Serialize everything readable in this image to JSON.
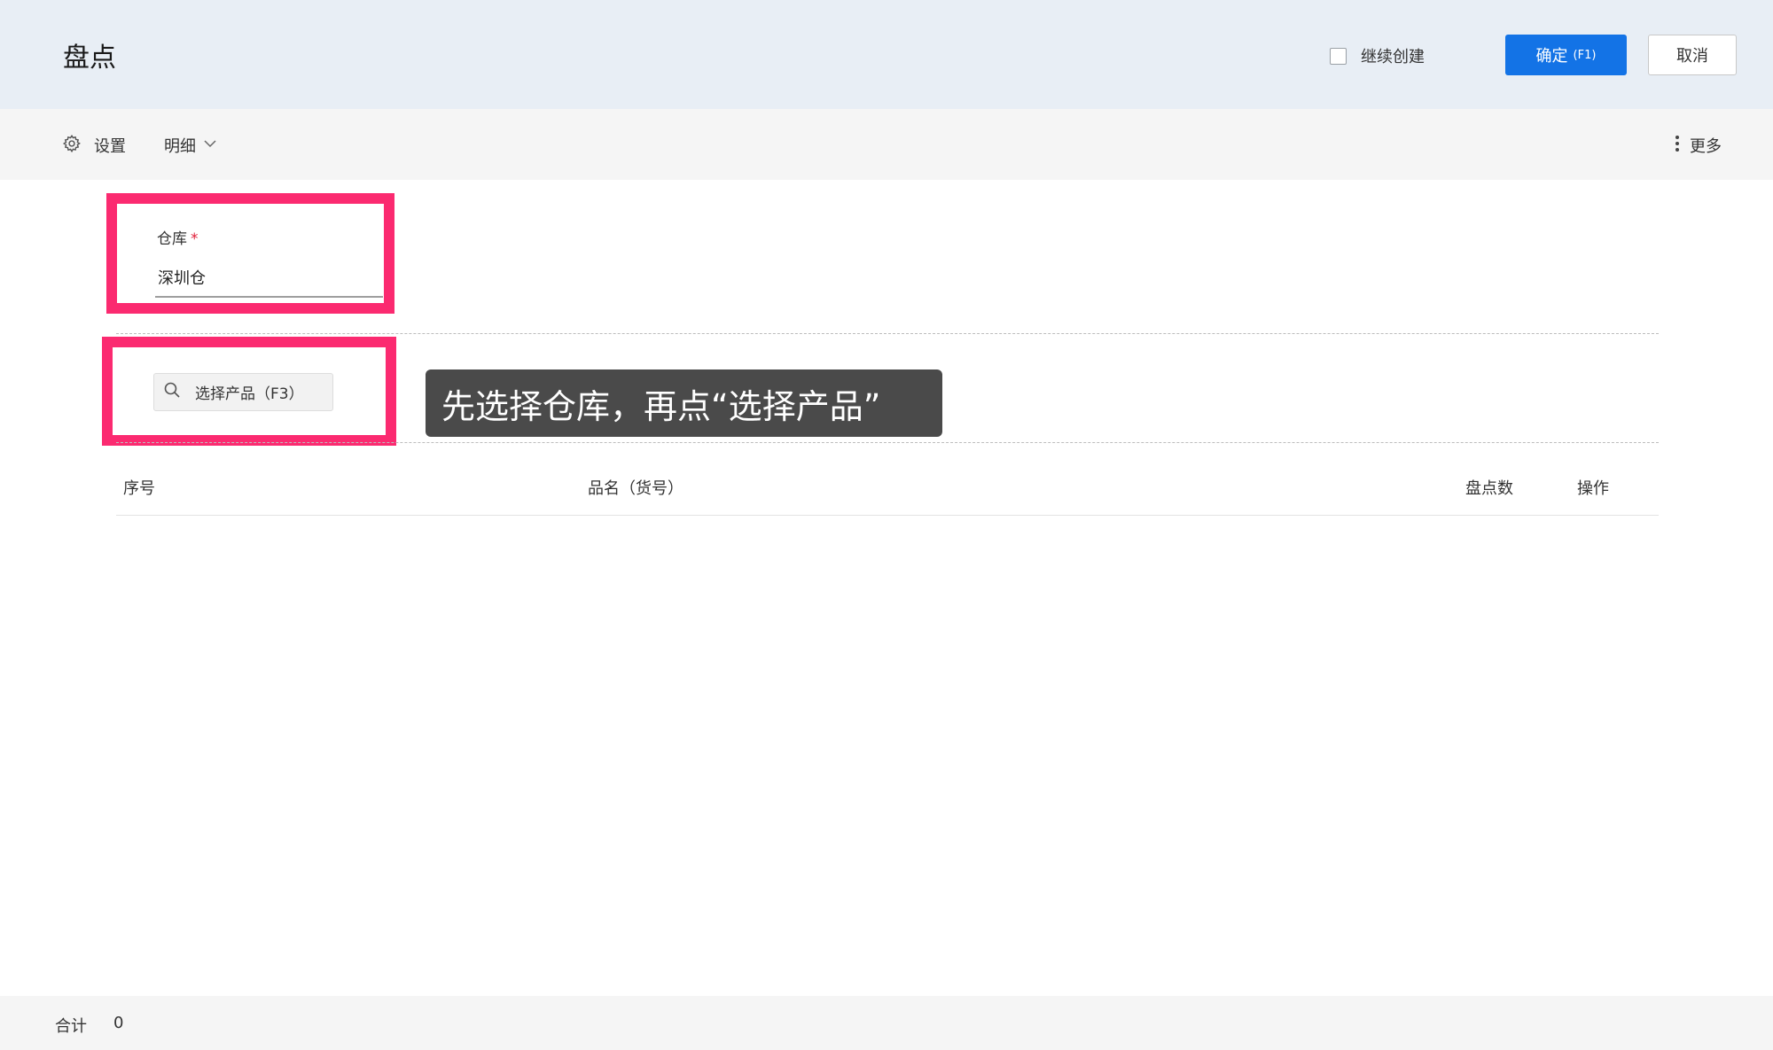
{
  "header": {
    "title": "盘点",
    "continue_create": "继续创建",
    "confirm": "确定",
    "confirm_shortcut": "(F1)",
    "cancel": "取消"
  },
  "toolbar": {
    "settings": "设置",
    "detail": "明细",
    "more": "更多"
  },
  "warehouse": {
    "label": "仓库",
    "required_mark": "*",
    "value": "深圳仓"
  },
  "product": {
    "select_label": "选择产品（F3）"
  },
  "tip": {
    "text": "先选择仓库，再点“选择产品”"
  },
  "table": {
    "columns": [
      "序号",
      "品名（货号）",
      "盘点数",
      "操作"
    ]
  },
  "footer": {
    "total_label": "合计",
    "total_value": "0"
  },
  "colors": {
    "primary": "#1373e6",
    "highlight": "#fb2a70",
    "required": "#e0203a"
  }
}
